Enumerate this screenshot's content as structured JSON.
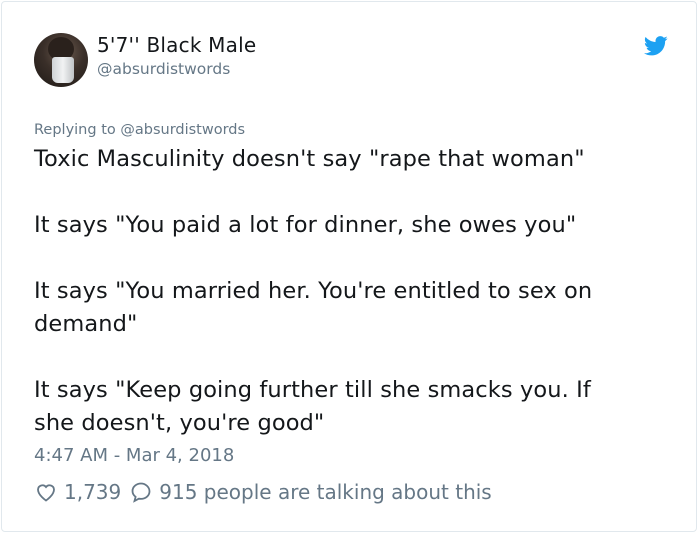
{
  "author": {
    "display_name": "5'7'' Black Male",
    "handle": "@absurdistwords"
  },
  "replying_to": "Replying to @absurdistwords",
  "tweet_lines": [
    "Toxic Masculinity doesn't say \"rape that woman\"",
    "It says \"You paid a lot for dinner, she owes you\"",
    "It says \"You married her. You're entitled to sex on",
    "demand\"",
    "It says \"Keep going further till she smacks you. If",
    "she doesn't, you're good\""
  ],
  "timestamp": "4:47 AM - Mar 4, 2018",
  "actions": {
    "like_count": "1,739",
    "talking_text": "915 people are talking about this"
  },
  "colors": {
    "twitter_blue": "#1da1f2",
    "secondary_text": "#657786",
    "primary_text": "#14171a"
  },
  "icons": [
    "twitter-bird-icon",
    "heart-icon",
    "comment-bubble-icon"
  ]
}
